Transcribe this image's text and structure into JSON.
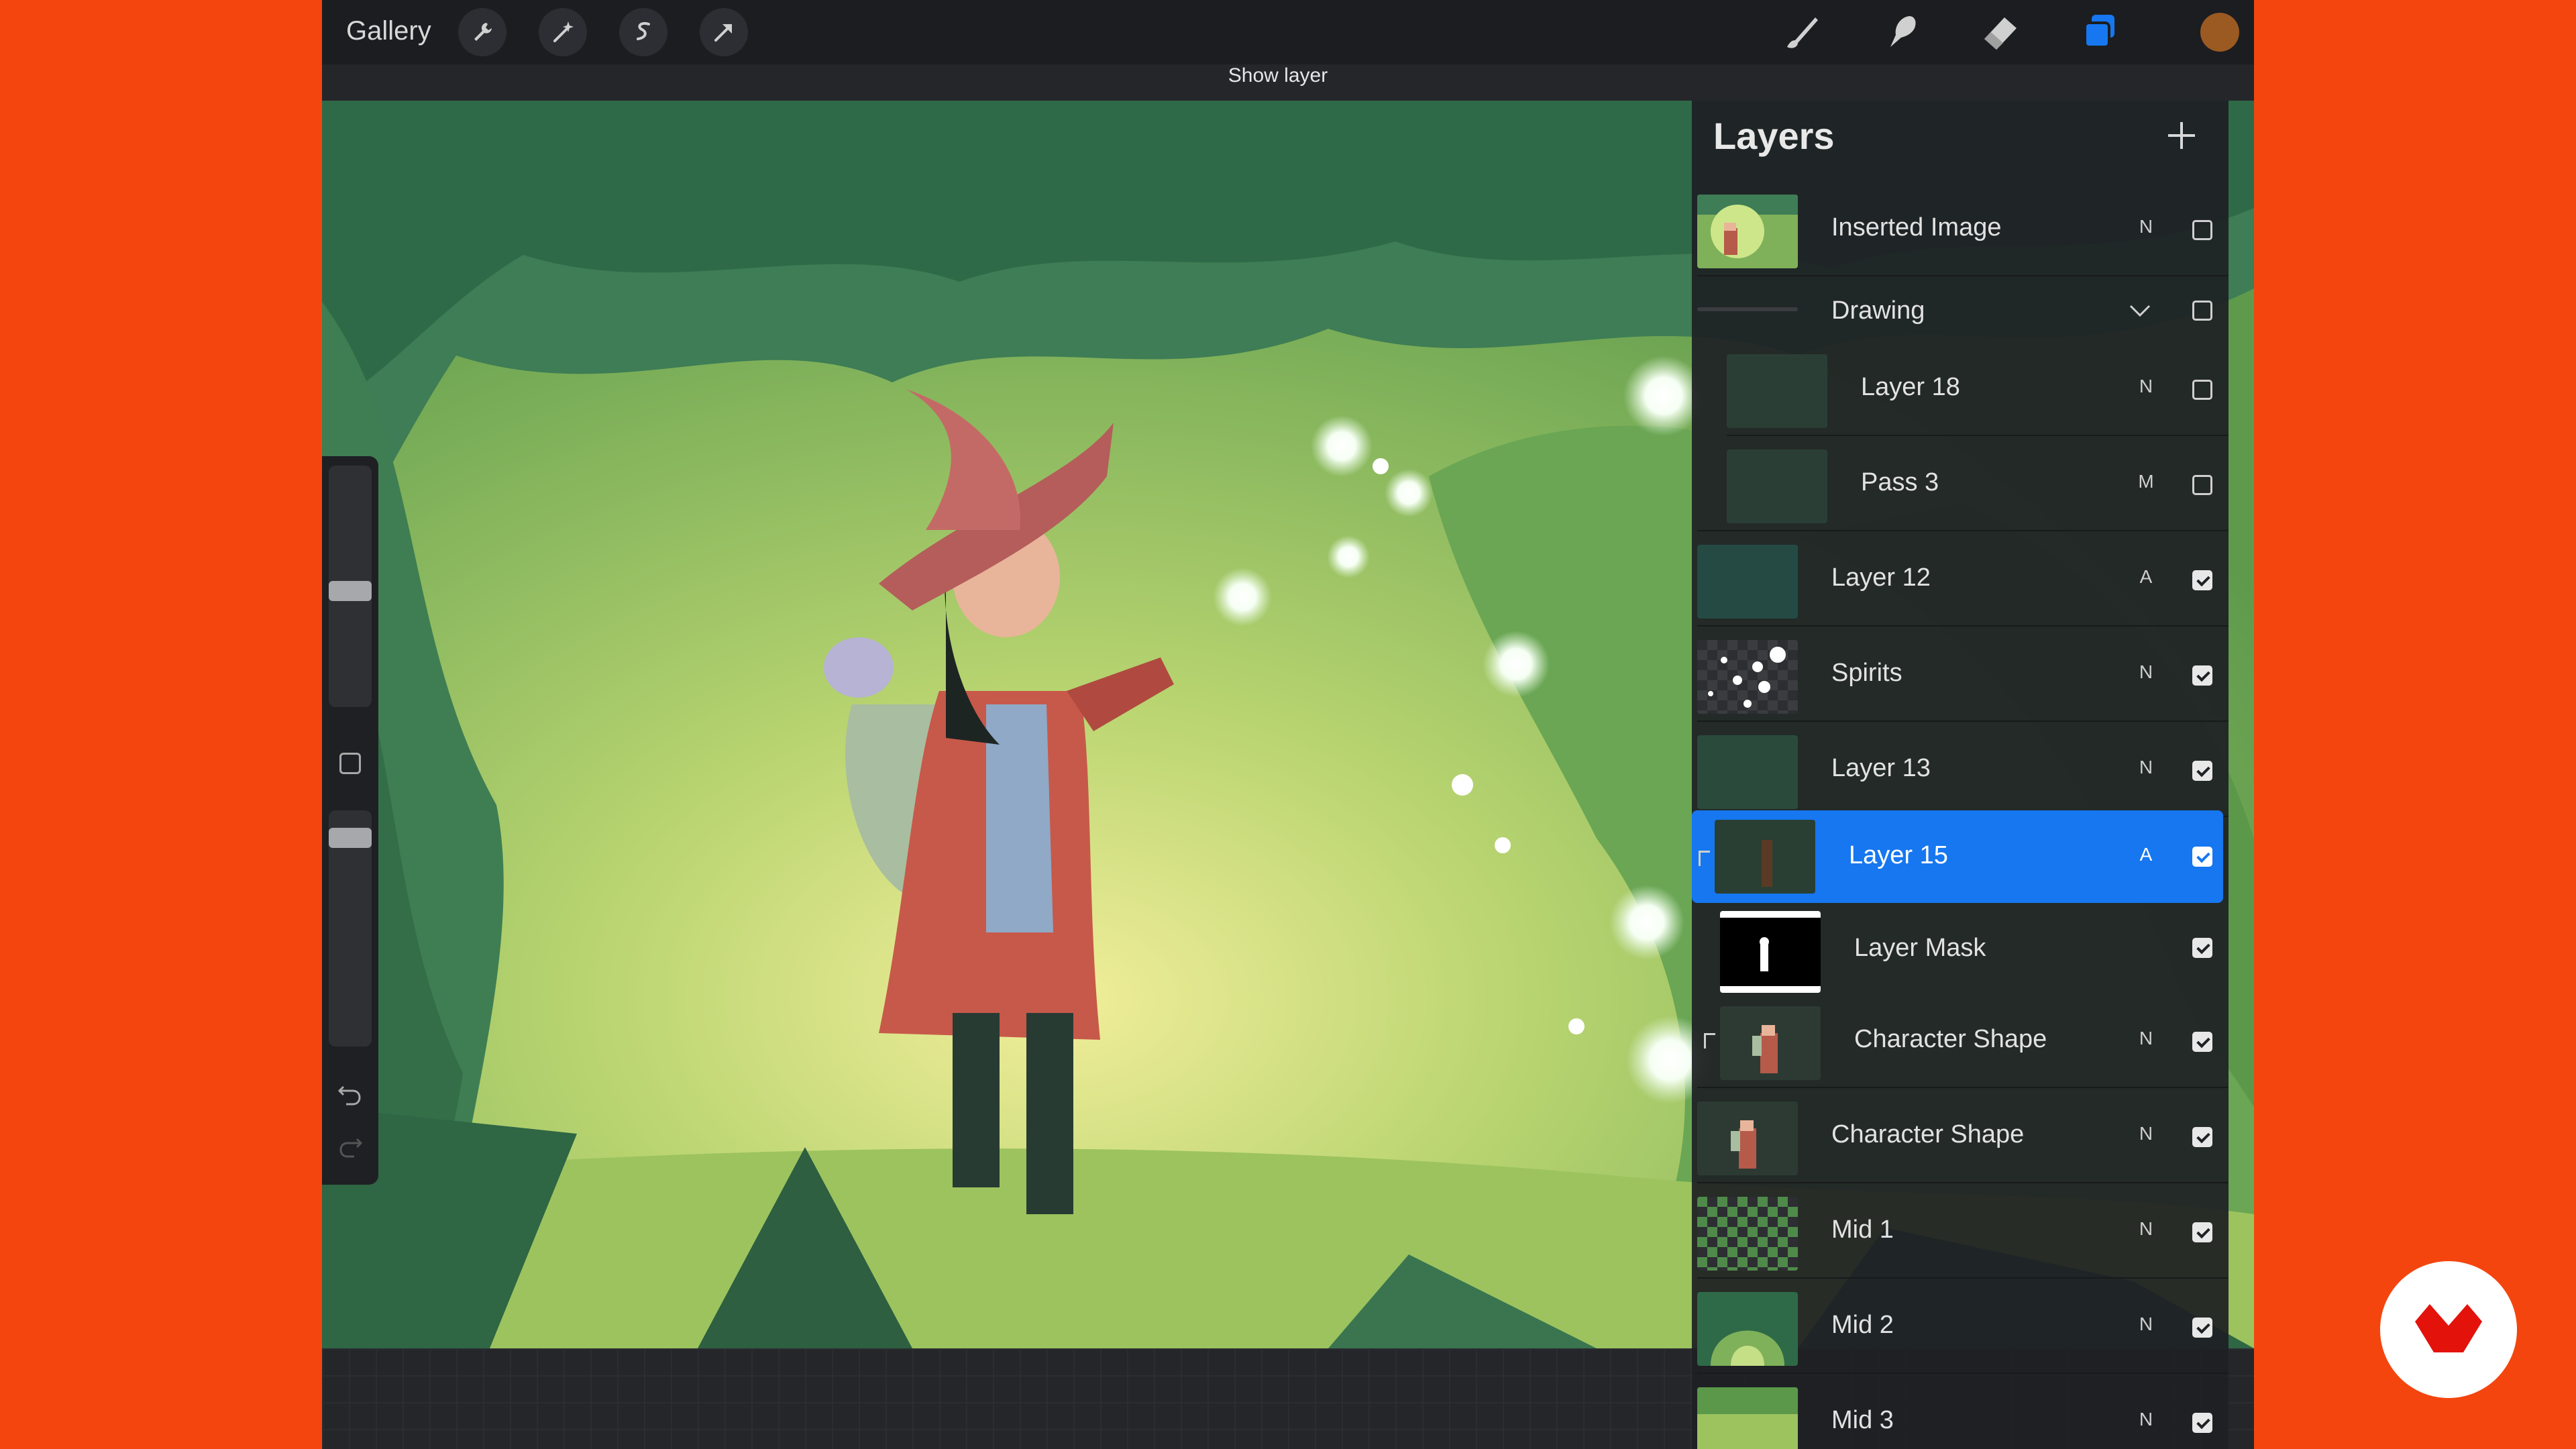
{
  "toolbar": {
    "gallery_label": "Gallery",
    "left_tools": [
      "wrench-icon",
      "magic-wand-icon",
      "selection-icon",
      "transform-arrow-icon"
    ],
    "right_tools": [
      "brush-icon",
      "smudge-icon",
      "eraser-icon",
      "layers-icon"
    ],
    "current_color": "#9a5a22",
    "active_tool_color": "#1677f0"
  },
  "tooltip": "Show layer",
  "layers_panel": {
    "title": "Layers",
    "add_icon": "plus-icon",
    "rows": [
      {
        "name": "Inserted Image",
        "mode": "N",
        "visible": false,
        "selected": false,
        "indent": 0,
        "thumb": "scene"
      },
      {
        "name": "Drawing",
        "mode": "",
        "visible": false,
        "selected": false,
        "indent": 0,
        "thumb": "group",
        "group_expanded": true
      },
      {
        "name": "Layer 18",
        "mode": "N",
        "visible": false,
        "selected": false,
        "indent": 1,
        "thumb": "sketch"
      },
      {
        "name": "Pass 3",
        "mode": "M",
        "visible": false,
        "selected": false,
        "indent": 1,
        "thumb": "sketch"
      },
      {
        "name": "Layer 12",
        "mode": "A",
        "visible": true,
        "selected": false,
        "indent": 0,
        "thumb": "dark-teal"
      },
      {
        "name": "Spirits",
        "mode": "N",
        "visible": true,
        "selected": false,
        "indent": 0,
        "thumb": "spirits"
      },
      {
        "name": "Layer 13",
        "mode": "N",
        "visible": true,
        "selected": false,
        "indent": 0,
        "thumb": "dark-green"
      },
      {
        "name": "Layer 15",
        "mode": "A",
        "visible": true,
        "selected": true,
        "indent": 0,
        "thumb": "character-dark",
        "clipped": true
      },
      {
        "name": "Layer Mask",
        "mode": "",
        "visible": true,
        "selected": false,
        "indent": 0,
        "thumb": "mask"
      },
      {
        "name": "Character Shape",
        "mode": "N",
        "visible": true,
        "selected": false,
        "indent": 0,
        "thumb": "character",
        "clipped": true
      },
      {
        "name": "Character Shape",
        "mode": "N",
        "visible": true,
        "selected": false,
        "indent": 0,
        "thumb": "character"
      },
      {
        "name": "Mid 1",
        "mode": "N",
        "visible": true,
        "selected": false,
        "indent": 0,
        "thumb": "checker-green"
      },
      {
        "name": "Mid 2",
        "mode": "N",
        "visible": true,
        "selected": false,
        "indent": 0,
        "thumb": "green-arch"
      },
      {
        "name": "Mid 3",
        "mode": "N",
        "visible": true,
        "selected": false,
        "indent": 0,
        "thumb": "green-light"
      }
    ]
  },
  "sidebar": {
    "brush_size_level": 0.48,
    "opacity_level": 0.08,
    "undo_icon": "undo-icon",
    "redo_icon": "redo-icon",
    "modify_icon": "square-modify-icon"
  },
  "brand": {
    "icon": "brand-logo-icon",
    "color": "#e3120b"
  }
}
